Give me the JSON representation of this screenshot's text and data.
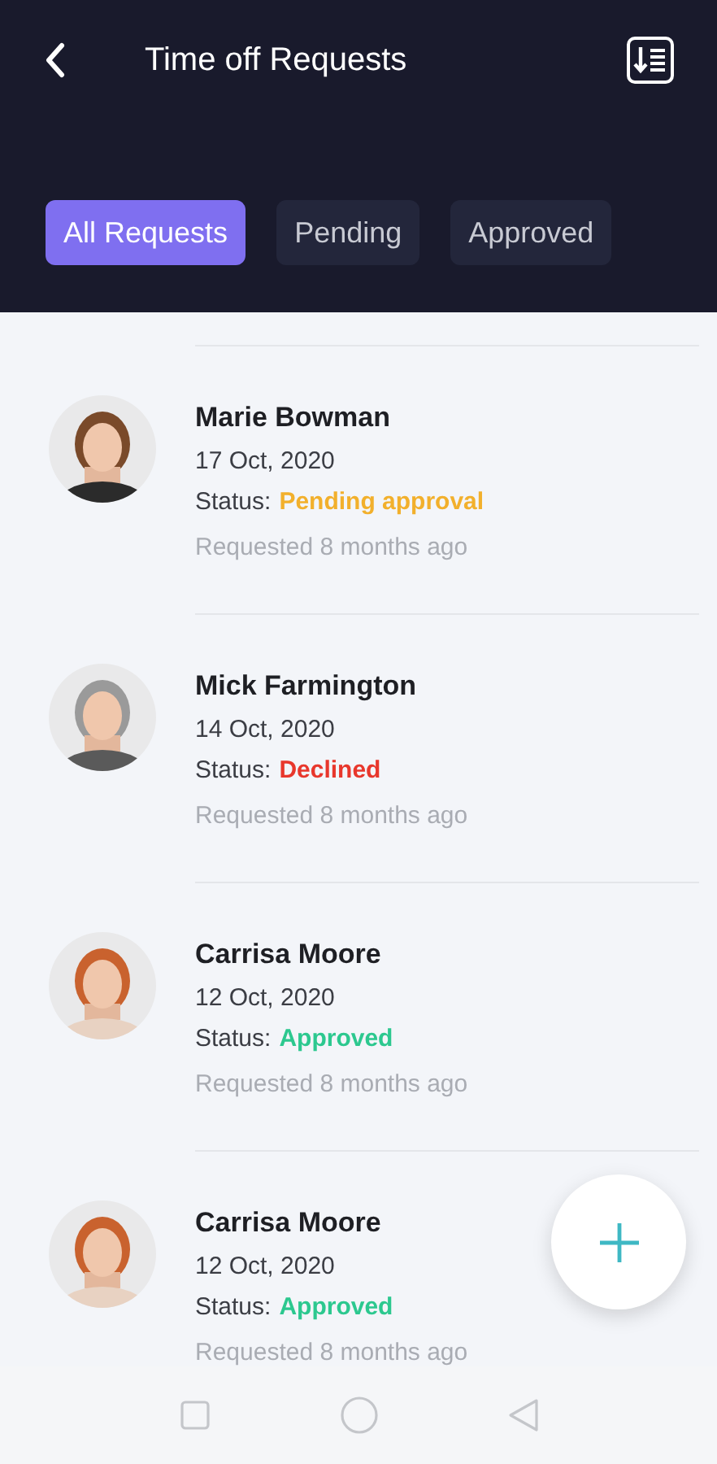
{
  "header": {
    "title": "Time off Requests"
  },
  "tabs": [
    {
      "label": "All Requests",
      "selected": true
    },
    {
      "label": "Pending",
      "selected": false
    },
    {
      "label": "Approved",
      "selected": false
    }
  ],
  "requests": [
    {
      "name": "Marie Bowman",
      "date": "17 Oct, 2020",
      "status_label": "Status:",
      "status": "Pending approval",
      "color": "#f2b02c",
      "requested": "Requested 8 months ago"
    },
    {
      "name": "Mick Farmington",
      "date": "14 Oct, 2020",
      "status_label": "Status:",
      "status": "Declined",
      "color": "#e8372c",
      "requested": "Requested 8 months ago"
    },
    {
      "name": "Carrisa Moore",
      "date": "12 Oct, 2020",
      "status_label": "Status:",
      "status": "Approved",
      "color": "#2cc88f",
      "requested": "Requested 8 months ago"
    },
    {
      "name": "Carrisa Moore",
      "date": "12 Oct, 2020",
      "status_label": "Status:",
      "status": "Approved",
      "color": "#2cc88f",
      "requested": "Requested 8 months ago"
    }
  ]
}
